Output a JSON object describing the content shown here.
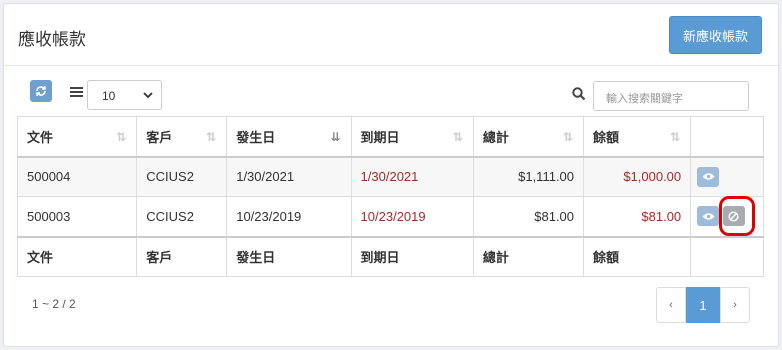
{
  "panel": {
    "title": "應收帳款",
    "new_button": "新應收帳款"
  },
  "toolbar": {
    "page_size": "10",
    "search_placeholder": "輸入搜索關鍵字"
  },
  "table": {
    "headers": [
      "文件",
      "客戶",
      "發生日",
      "到期日",
      "總計",
      "餘額"
    ],
    "rows": [
      {
        "doc": "500004",
        "customer": "CCIUS2",
        "issue_date": "1/30/2021",
        "due_date": "1/30/2021",
        "total": "$1,111.00",
        "balance": "$1,000.00"
      },
      {
        "doc": "500003",
        "customer": "CCIUS2",
        "issue_date": "10/23/2019",
        "due_date": "10/23/2019",
        "total": "$81.00",
        "balance": "$81.00"
      }
    ],
    "footer": [
      "文件",
      "客戶",
      "發生日",
      "到期日",
      "總計",
      "餘額"
    ]
  },
  "pagination": {
    "info": "1 ~ 2 / 2",
    "prev": "‹",
    "current": "1",
    "next": "›"
  },
  "colors": {
    "primary": "#5b9bd5",
    "due_red": "#a52a2a",
    "highlight": "#e00000"
  }
}
